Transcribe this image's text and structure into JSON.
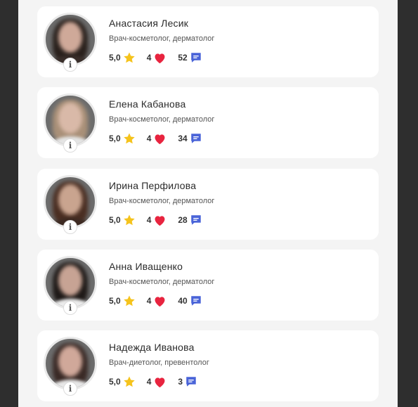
{
  "doctors": [
    {
      "name": "Анастасия Лесик",
      "specialty": "Врач-косметолог, дерматолог",
      "rating": "5,0",
      "likes": "4",
      "reviews": "52"
    },
    {
      "name": "Елена Кабанова",
      "specialty": "Врач-косметолог, дерматолог",
      "rating": "5,0",
      "likes": "4",
      "reviews": "34"
    },
    {
      "name": "Ирина Перфилова",
      "specialty": "Врач-косметолог, дерматолог",
      "rating": "5,0",
      "likes": "4",
      "reviews": "28"
    },
    {
      "name": "Анна Иващенко",
      "specialty": "Врач-косметолог, дерматолог",
      "rating": "5,0",
      "likes": "4",
      "reviews": "40"
    },
    {
      "name": "Надежда Иванова",
      "specialty": "Врач-диетолог, превентолог",
      "rating": "5,0",
      "likes": "4",
      "reviews": "3"
    }
  ],
  "info_badge": "i",
  "icons": {
    "rating": "star-icon",
    "likes": "heart-icon",
    "reviews": "comment-icon"
  },
  "colors": {
    "star": "#f5c31c",
    "heart": "#e8243f",
    "comment": "#4a64d8"
  }
}
